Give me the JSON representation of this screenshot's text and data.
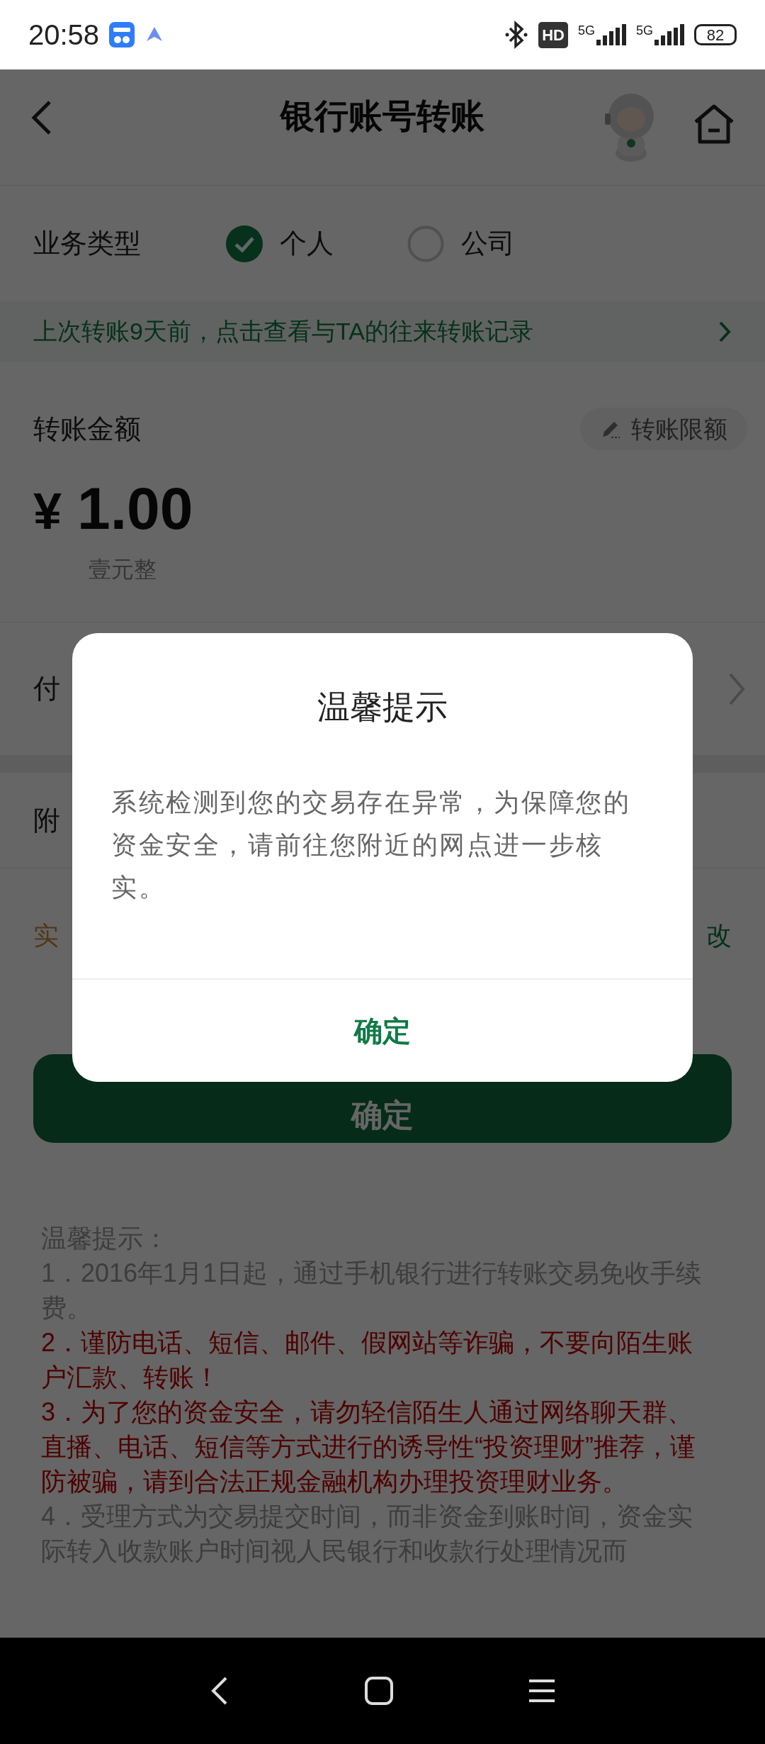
{
  "status_bar": {
    "time": "20:58",
    "hd_badge": "HD",
    "networks": [
      "5G",
      "5G"
    ],
    "battery": "82"
  },
  "header": {
    "title": "银行账号转账"
  },
  "business_type": {
    "label": "业务类型",
    "options": [
      {
        "label": "个人",
        "selected": true
      },
      {
        "label": "公司",
        "selected": false
      }
    ]
  },
  "history_notice": {
    "text": "上次转账9天前，点击查看与TA的往来转账记录"
  },
  "amount": {
    "label": "转账金额",
    "limit_button": "转账限额",
    "currency": "¥",
    "value": "1.00",
    "in_words": "壹元整"
  },
  "payer": {
    "label": "付"
  },
  "remark": {
    "label": "附"
  },
  "arrival": {
    "label": "实",
    "action": "改"
  },
  "confirm_button": "确定",
  "notes": {
    "title": "温馨提示：",
    "items": [
      {
        "kind": "normal",
        "text": "1．2016年1月1日起，通过手机银行进行转账交易免收手续费。"
      },
      {
        "kind": "warning",
        "text": "2．谨防电话、短信、邮件、假网站等诈骗，不要向陌生账户汇款、转账！"
      },
      {
        "kind": "warning",
        "text": "3．为了您的资金安全，请勿轻信陌生人通过网络聊天群、直播、电话、短信等方式进行的诱导性“投资理财”推荐，谨防被骗，请到合法正规金融机构办理投资理财业务。"
      },
      {
        "kind": "normal",
        "text": "4．受理方式为交易提交时间，而非资金到账时间，资金实际转入收款账户时间视人民银行和收款行处理情况而"
      }
    ]
  },
  "dialog": {
    "title": "温馨提示",
    "message": "系统检测到您的交易存在异常，为保障您的资金安全，请前往您附近的网点进一步核实。",
    "button": "确定"
  }
}
